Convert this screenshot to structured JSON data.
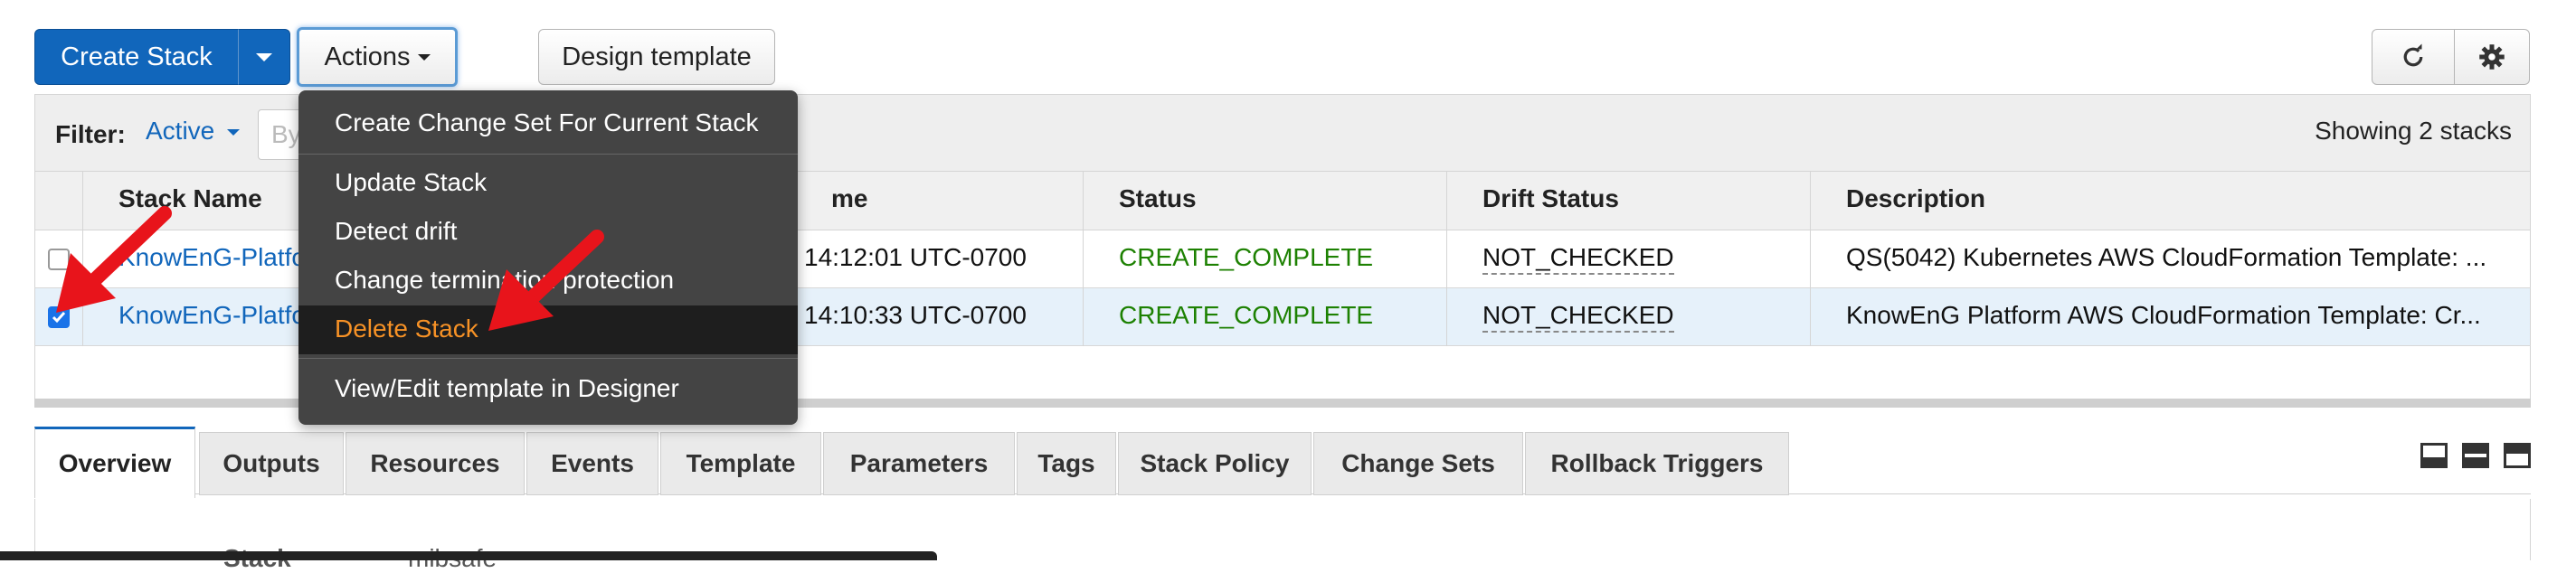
{
  "toolbar": {
    "create_stack_label": "Create Stack",
    "actions_label": "Actions",
    "design_template_label": "Design template",
    "refresh_icon": "refresh-icon",
    "settings_icon": "gear-icon"
  },
  "filter": {
    "label": "Filter:",
    "active_label": "Active",
    "search_placeholder": "By",
    "showing_text": "Showing 2 stacks"
  },
  "table": {
    "columns": [
      "Stack Name",
      "me",
      "Status",
      "Drift Status",
      "Description"
    ],
    "rows": [
      {
        "stack_name": "KnowEnG-Platfo",
        "created_time": "14:12:01 UTC-0700",
        "status": "CREATE_COMPLETE",
        "drift_status": "NOT_CHECKED",
        "description": "QS(5042) Kubernetes AWS CloudFormation Template: ...",
        "selected": false
      },
      {
        "stack_name": "KnowEnG-Platfo",
        "created_time": "14:10:33 UTC-0700",
        "status": "CREATE_COMPLETE",
        "drift_status": "NOT_CHECKED",
        "description": "KnowEnG Platform AWS CloudFormation Template: Cr...",
        "selected": true
      }
    ]
  },
  "actions_menu": {
    "items": [
      "Create Change Set For Current Stack",
      "Update Stack",
      "Detect drift",
      "Change termination protection",
      "Delete Stack",
      "View/Edit template in Designer"
    ],
    "highlighted": "Delete Stack"
  },
  "tabs": [
    "Overview",
    "Outputs",
    "Resources",
    "Events",
    "Template",
    "Parameters",
    "Tags",
    "Stack Policy",
    "Change Sets",
    "Rollback Triggers"
  ],
  "active_tab": "Overview",
  "details_partial": {
    "label": "Stack",
    "value": "mibsafe"
  },
  "colors": {
    "primary_blue": "#1166bb",
    "status_green": "#1d8102",
    "danger_orange": "#f79226",
    "annotation_red": "#e8141b"
  }
}
